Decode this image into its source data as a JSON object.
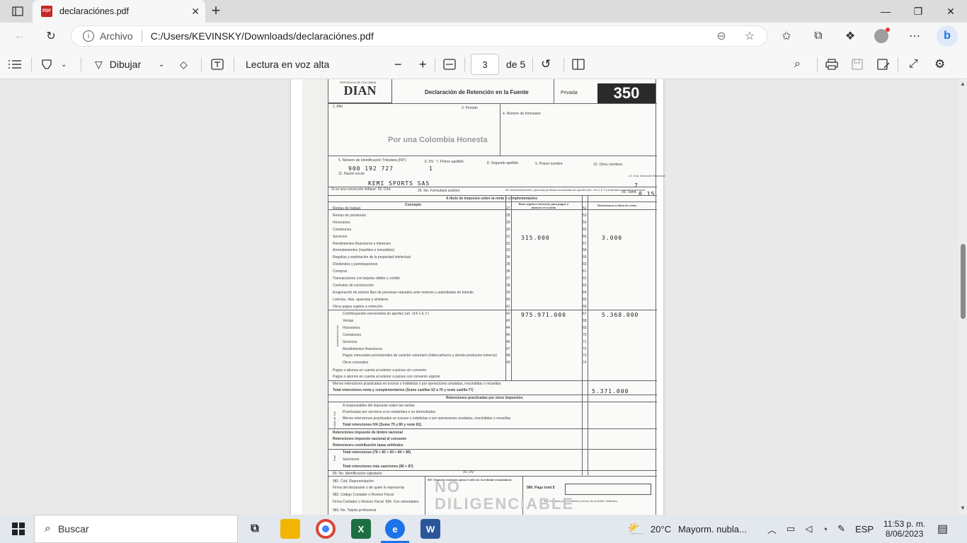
{
  "browser": {
    "tab_title": "declaraciónes.pdf",
    "address_label": "Archivo",
    "address_url": "C:/Users/KEVINSKY/Downloads/declaraciónes.pdf"
  },
  "pdf_toolbar": {
    "draw_label": "Dibujar",
    "read_aloud_label": "Lectura en voz alta",
    "current_page": "3",
    "page_total": "de 5"
  },
  "document": {
    "republic": "REPÚBLICA DE COLOMBIA",
    "logo": "DIAN",
    "form_title": "Declaración de Retención en la Fuente",
    "privada": "Privada",
    "form_number": "350",
    "slogan": "Por una Colombia Honesta",
    "field_ano": "1. Año",
    "field_periodo": "3. Periodo",
    "field_numero": "4. Número de formulario",
    "nit_label": "5. Número de Identificación Tributaria (NIT)",
    "dv_label": "6. DV.",
    "primer_apellido": "7. Primer apellido",
    "segundo_apellido": "8. Segundo apellido",
    "primer_nombre": "9. Primer nombre",
    "otros_nombres": "10. Otros nombres",
    "razon_social_label": "11. Razón social",
    "nit_value": "900 192 727",
    "dv_value": "1",
    "razon_social_value": "KEMI SPORTS SAS",
    "seccional_label": "12. Cód. Dirección Seccional",
    "seccional_value": "7",
    "correccion": "Si es una corrección indique:  25. Cód.",
    "formulario_anterior": "26. No. Formulario anterior",
    "autorretenedores": "98. Autorretenedores, personas jurídicas exoneradas de aportes (Art. 114-1 E.T.)  Actividad económica principal",
    "tarifa_label": "99. Tarifa",
    "tarifa_value": "0.15",
    "section_renta": "A título de impuesto sobre la renta y complementarios",
    "col_concepto": "Concepto",
    "col_base": "Base sujeta a retención para pagos o abonos en cuenta",
    "col_retenciones": "Retenciones a título de renta",
    "rows": [
      {
        "label": "Rentas de trabajo",
        "n1": "27",
        "n2": "52",
        "base": "",
        "ret": ""
      },
      {
        "label": "Rentas de pensiones",
        "n1": "28",
        "n2": "53",
        "base": "",
        "ret": ""
      },
      {
        "label": "Honorarios",
        "n1": "29",
        "n2": "54",
        "base": "",
        "ret": ""
      },
      {
        "label": "Comisiones",
        "n1": "30",
        "n2": "55",
        "base": "",
        "ret": ""
      },
      {
        "label": "Servicios",
        "n1": "31",
        "n2": "56",
        "base": "315.000",
        "ret": "3.000"
      },
      {
        "label": "Rendimientos financieros e intereses",
        "n1": "32",
        "n2": "57",
        "base": "",
        "ret": ""
      },
      {
        "label": "Arrendamientos (muebles e inmuebles)",
        "n1": "33",
        "n2": "58",
        "base": "",
        "ret": ""
      },
      {
        "label": "Regalías y explotación de la propiedad intelectual",
        "n1": "34",
        "n2": "59",
        "base": "",
        "ret": ""
      },
      {
        "label": "Dividendos y participaciones",
        "n1": "35",
        "n2": "60",
        "base": "",
        "ret": ""
      },
      {
        "label": "Compras",
        "n1": "36",
        "n2": "61",
        "base": "",
        "ret": ""
      },
      {
        "label": "Transacciones con tarjetas débito y crédito",
        "n1": "37",
        "n2": "62",
        "base": "",
        "ret": ""
      },
      {
        "label": "Contratos de construcción",
        "n1": "38",
        "n2": "63",
        "base": "",
        "ret": ""
      },
      {
        "label": "Enajenación de activos fijos de personas naturales ante notarios y autoridades de tránsito",
        "n1": "39",
        "n2": "64",
        "base": "",
        "ret": ""
      },
      {
        "label": "Loterías, rifas, apuestas y similares",
        "n1": "40",
        "n2": "65",
        "base": "",
        "ret": ""
      },
      {
        "label": "Otros pagos sujetos a retención",
        "n1": "41",
        "n2": "66",
        "base": "",
        "ret": ""
      }
    ],
    "auto_label": "Autorretenciones",
    "auto_rows": [
      {
        "label": "Contribuyentes exonerados de aportes (art. 114-1 E.T.)",
        "n1": "42",
        "n2": "67",
        "base": "975.971.000",
        "ret": "5.368.000"
      },
      {
        "label": "Ventas",
        "n1": "43",
        "n2": "68",
        "base": "",
        "ret": ""
      },
      {
        "label": "Honorarios",
        "n1": "44",
        "n2": "69",
        "base": "",
        "ret": ""
      },
      {
        "label": "Comisiones",
        "n1": "45",
        "n2": "70",
        "base": "",
        "ret": ""
      },
      {
        "label": "Servicios",
        "n1": "46",
        "n2": "71",
        "base": "",
        "ret": ""
      },
      {
        "label": "Rendimientos financieros",
        "n1": "47",
        "n2": "72",
        "base": "",
        "ret": ""
      },
      {
        "label": "Pagos mensuales provisionales de carácter voluntario (hidrocarburos y demás productos mineros)",
        "n1": "48",
        "n2": "73",
        "base": "",
        "ret": ""
      },
      {
        "label": "Otros conceptos",
        "n1": "49",
        "n2": "74",
        "base": "",
        "ret": ""
      }
    ],
    "exterior1": "Pagos o abonos en cuenta al exterior a países sin convenio",
    "exterior2": "Pagos o abonos en cuenta al exterior a países con convenio vigente",
    "menos_ret": "Menos retenciones practicadas en exceso o indebidas o por operaciones anuladas, rescindidas o resueltas",
    "total_renta": "Total retenciones renta y complementarios (Sume casillas 52 a 76 y reste casilla 77)",
    "total_renta_value": "5.371.000",
    "section_otros": "Retenciones practicadas por otros impuestos",
    "iva_label": "A título de IVA",
    "iva1": "A responsables del impuesto sobre las ventas",
    "iva2": "Practicadas por servicios a no residentes o no domiciliados",
    "iva3": "Menos retenciones practicadas en exceso o indebidas o por operaciones anuladas, rescindidas o resueltas",
    "iva_total": "Total retenciones IVA (Sume 79 y 80 y reste 81)",
    "timbre": "Retenciones impuesto de timbre nacional",
    "consumo": "Retenciones impuesto nacional al consumo",
    "bomberil": "Retenciones contribución tasas arbitrales",
    "total_label": "Total",
    "total1": "Total retenciones (78 + 82 + 83 + 84 + 85)",
    "total2": "Sanciones",
    "total3": "Total retenciones más sanciones (86 + 87)",
    "firma1": "89. No. Identificación signatario",
    "firma_dv": "90. DV",
    "firma2": "981. Cód. Representación",
    "firma3": "Firma del declarante o de quien lo representa",
    "firma4": "982. Código Contador o Revisor Fiscal",
    "firma5": "Firma Contador o Revisor Fiscal.  994. Con salvedades",
    "firma6": "983. No. Tarjeta profesional",
    "espacio_banco": "997. Espacio exclusivo para el sello de la entidad recaudadora",
    "pago_total": "980. Pago total $",
    "espacio_dian": "996. Espacio para el número interno de la DIAN / Adhesivo",
    "stamp_text": "NO DILIGENCIABLE"
  },
  "taskbar": {
    "search_placeholder": "Buscar",
    "weather_temp": "20°C",
    "weather_desc": "Mayorm. nubla...",
    "language": "ESP",
    "time": "11:53 p. m.",
    "date": "8/06/2023"
  },
  "colors": {
    "edge_blue": "#1a73e8",
    "pdf_red": "#c62828",
    "excel_green": "#1d6f42",
    "word_blue": "#2b579a"
  }
}
